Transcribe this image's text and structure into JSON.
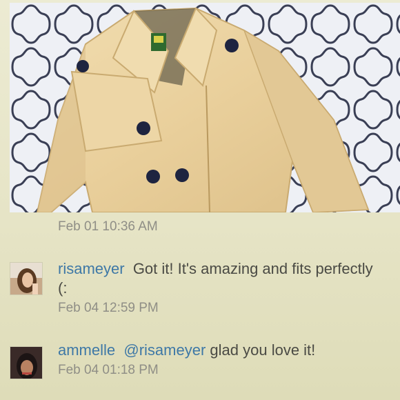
{
  "photo": {
    "alt": "beige trench coat with navy buttons"
  },
  "listing_time": "Feb 01 10:36 AM",
  "comments": [
    {
      "username": "risameyer",
      "text": "Got it! It's amazing and fits perfectly (:",
      "time": "Feb 04 12:59 PM"
    },
    {
      "username": "ammelle",
      "mention": "@risameyer",
      "text": "glad you love it!",
      "time": "Feb 04 01:18 PM"
    }
  ],
  "colors": {
    "username": "#3e78a6",
    "text": "#4a4a44",
    "timestamp": "#8f8e86",
    "background": "#e6e4c6"
  }
}
